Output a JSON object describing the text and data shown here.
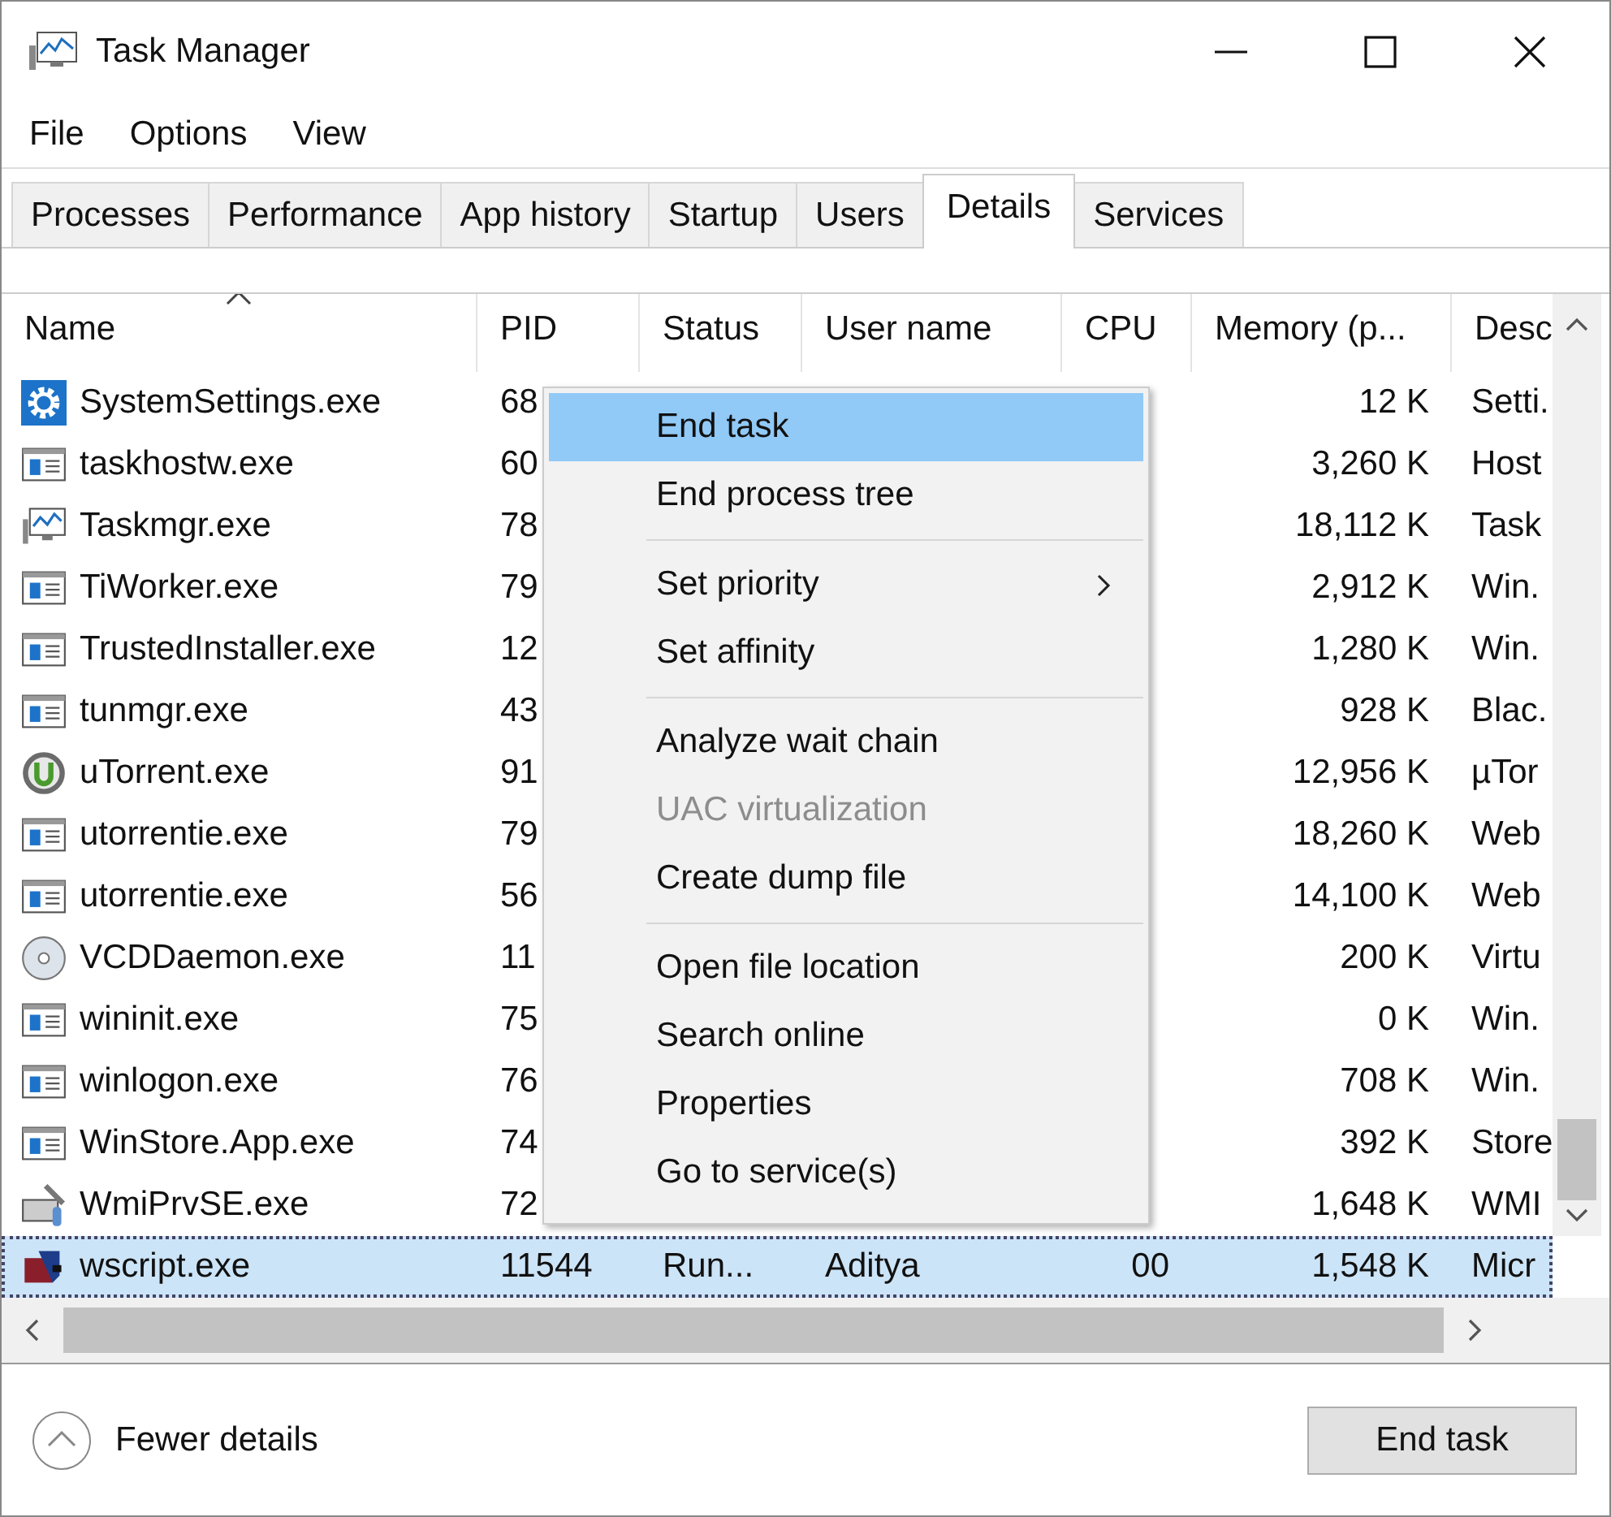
{
  "window": {
    "title": "Task Manager"
  },
  "menu_bar": [
    "File",
    "Options",
    "View"
  ],
  "tabs": [
    {
      "label": "Processes",
      "selected": false
    },
    {
      "label": "Performance",
      "selected": false
    },
    {
      "label": "App history",
      "selected": false
    },
    {
      "label": "Startup",
      "selected": false
    },
    {
      "label": "Users",
      "selected": false
    },
    {
      "label": "Details",
      "selected": true
    },
    {
      "label": "Services",
      "selected": false
    }
  ],
  "table": {
    "columns": [
      {
        "label": "Name",
        "sorted": true
      },
      {
        "label": "PID",
        "sorted": false
      },
      {
        "label": "Status",
        "sorted": false
      },
      {
        "label": "User name",
        "sorted": false
      },
      {
        "label": "CPU",
        "sorted": false
      },
      {
        "label": "Memory (p...",
        "sorted": false
      },
      {
        "label": "Desc",
        "sorted": false
      }
    ],
    "rows": [
      {
        "kind": "gear",
        "name": "SystemSettings.exe",
        "pid": "68",
        "memory": "12 K",
        "description": "Setti.",
        "selected": false
      },
      {
        "kind": "app",
        "name": "taskhostw.exe",
        "pid": "60",
        "memory": "3,260 K",
        "description": "Host",
        "selected": false
      },
      {
        "kind": "monitor",
        "name": "Taskmgr.exe",
        "pid": "78",
        "memory": "18,112 K",
        "description": "Task",
        "selected": false
      },
      {
        "kind": "app",
        "name": "TiWorker.exe",
        "pid": "79",
        "memory": "2,912 K",
        "description": "Win.",
        "selected": false
      },
      {
        "kind": "app",
        "name": "TrustedInstaller.exe",
        "pid": "12",
        "memory": "1,280 K",
        "description": "Win.",
        "selected": false
      },
      {
        "kind": "app",
        "name": "tunmgr.exe",
        "pid": "43",
        "memory": "928 K",
        "description": "Blac.",
        "selected": false
      },
      {
        "kind": "torrent",
        "name": "uTorrent.exe",
        "pid": "91",
        "memory": "12,956 K",
        "description": "µTor",
        "selected": false
      },
      {
        "kind": "app",
        "name": "utorrentie.exe",
        "pid": "79",
        "memory": "18,260 K",
        "description": "Web",
        "selected": false
      },
      {
        "kind": "app",
        "name": "utorrentie.exe",
        "pid": "56",
        "memory": "14,100 K",
        "description": "Web",
        "selected": false
      },
      {
        "kind": "disc",
        "name": "VCDDaemon.exe",
        "pid": "11",
        "memory": "200 K",
        "description": "Virtu",
        "selected": false
      },
      {
        "kind": "app",
        "name": "wininit.exe",
        "pid": "75",
        "memory": "0 K",
        "description": "Win.",
        "selected": false
      },
      {
        "kind": "app",
        "name": "winlogon.exe",
        "pid": "76",
        "memory": "708 K",
        "description": "Win.",
        "selected": false
      },
      {
        "kind": "app",
        "name": "WinStore.App.exe",
        "pid": "74",
        "memory": "392 K",
        "description": "Store",
        "selected": false
      },
      {
        "kind": "tools",
        "name": "WmiPrvSE.exe",
        "pid": "72",
        "memory": "1,648 K",
        "description": "WMI",
        "selected": false
      },
      {
        "kind": "script",
        "name": "wscript.exe",
        "pid": "11544",
        "status": "Run...",
        "user": "Aditya",
        "cpu": "00",
        "memory": "1,548 K",
        "description": "Micr",
        "selected": true
      }
    ]
  },
  "context_menu": [
    {
      "label": "End task",
      "selected": true,
      "disabled": false,
      "separator_before": false,
      "submenu": false
    },
    {
      "label": "End process tree",
      "selected": false,
      "disabled": false,
      "separator_before": false,
      "submenu": false
    },
    {
      "label": "Set priority",
      "selected": false,
      "disabled": false,
      "separator_before": true,
      "submenu": true
    },
    {
      "label": "Set affinity",
      "selected": false,
      "disabled": false,
      "separator_before": false,
      "submenu": false
    },
    {
      "label": "Analyze wait chain",
      "selected": false,
      "disabled": false,
      "separator_before": true,
      "submenu": false
    },
    {
      "label": "UAC virtualization",
      "selected": false,
      "disabled": true,
      "separator_before": false,
      "submenu": false
    },
    {
      "label": "Create dump file",
      "selected": false,
      "disabled": false,
      "separator_before": false,
      "submenu": false
    },
    {
      "label": "Open file location",
      "selected": false,
      "disabled": false,
      "separator_before": true,
      "submenu": false
    },
    {
      "label": "Search online",
      "selected": false,
      "disabled": false,
      "separator_before": false,
      "submenu": false
    },
    {
      "label": "Properties",
      "selected": false,
      "disabled": false,
      "separator_before": false,
      "submenu": false
    },
    {
      "label": "Go to service(s)",
      "selected": false,
      "disabled": false,
      "separator_before": false,
      "submenu": false
    }
  ],
  "footer": {
    "toggle_label": "Fewer details",
    "button": "End task"
  }
}
